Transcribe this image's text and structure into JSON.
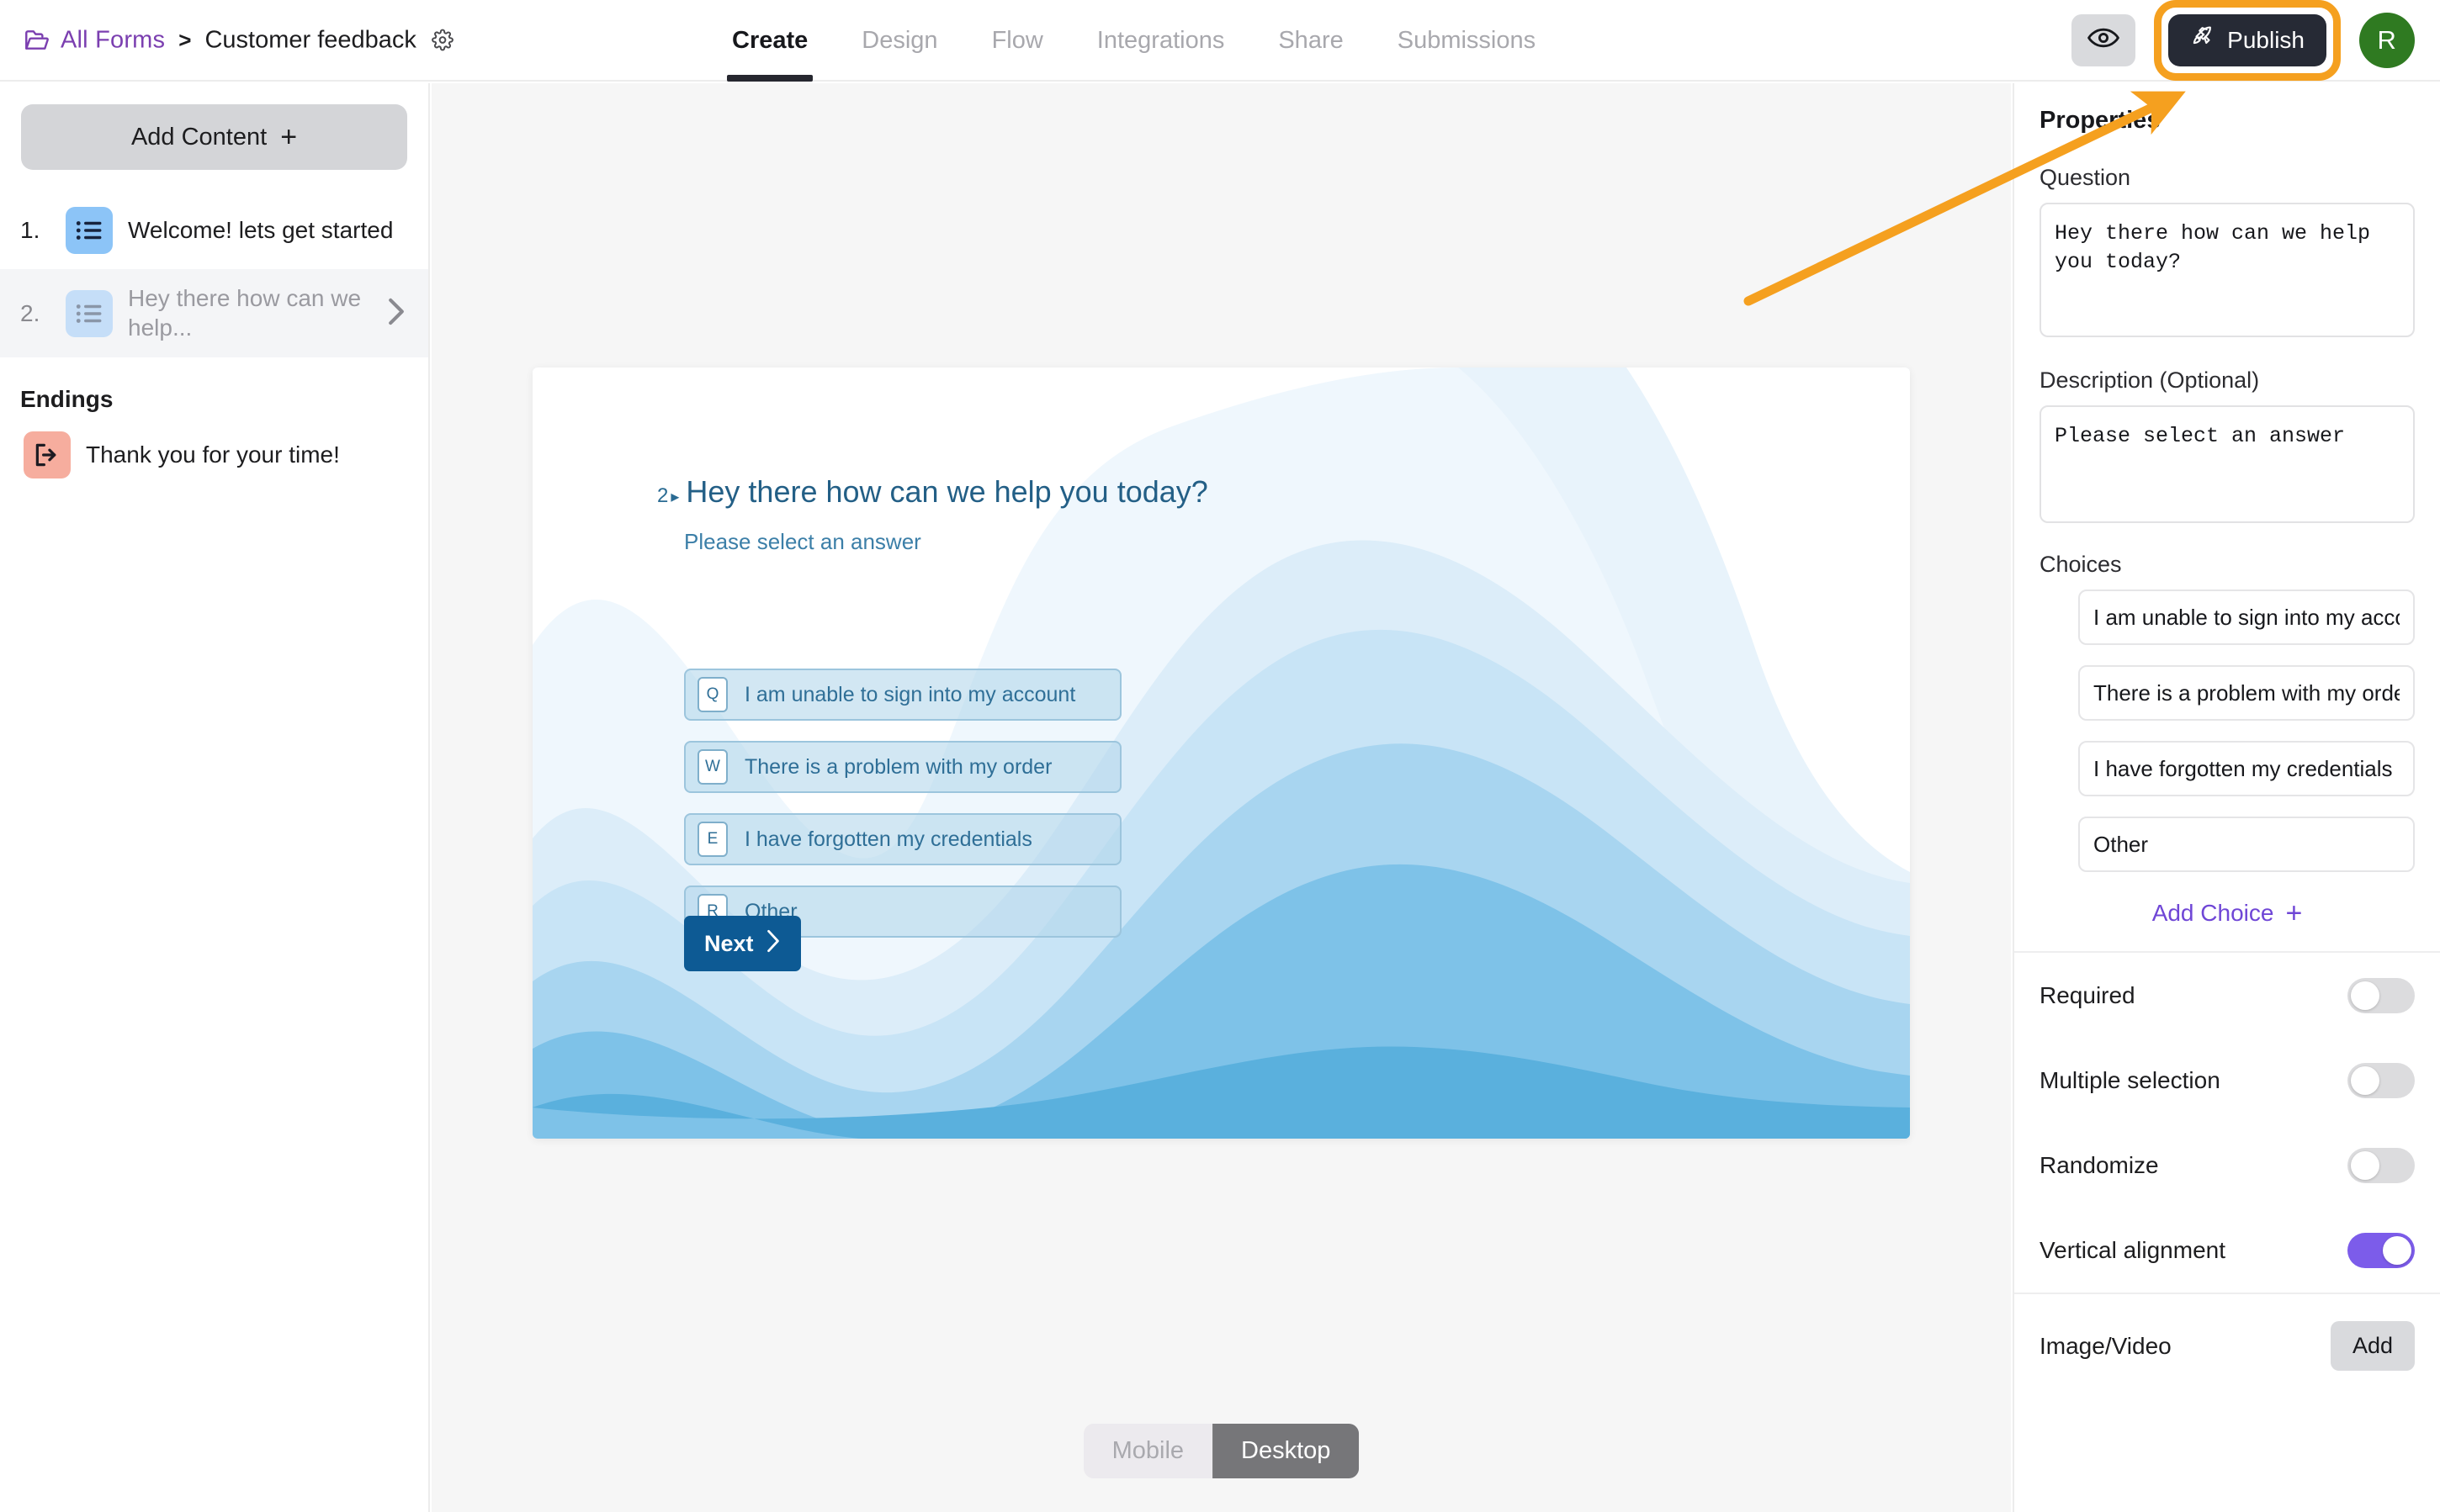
{
  "topbar": {
    "breadcrumb": {
      "all_forms": "All Forms",
      "separator": ">",
      "current": "Customer feedback"
    },
    "tabs": [
      {
        "label": "Create",
        "active": true
      },
      {
        "label": "Design",
        "active": false
      },
      {
        "label": "Flow",
        "active": false
      },
      {
        "label": "Integrations",
        "active": false
      },
      {
        "label": "Share",
        "active": false
      },
      {
        "label": "Submissions",
        "active": false
      }
    ],
    "preview_icon": "eye-icon",
    "publish_label": "Publish",
    "publish_icon": "rocket-icon",
    "avatar_initial": "R",
    "highlight_color": "#f5a01f",
    "publish_bg": "#262a35",
    "avatar_bg": "#2f7a21"
  },
  "sidebar": {
    "add_content_label": "Add Content",
    "items": [
      {
        "num": "1.",
        "label": "Welcome! lets get started",
        "icon": "list-icon",
        "selected": false
      },
      {
        "num": "2.",
        "label": "Hey there how can we help...",
        "icon": "list-icon",
        "selected": true
      }
    ],
    "endings_heading": "Endings",
    "endings": [
      {
        "label": "Thank you for your time!",
        "icon": "exit-icon"
      }
    ]
  },
  "preview": {
    "question_number": "2",
    "question": "Hey there how can we help you today?",
    "description": "Please select an answer",
    "choices": [
      {
        "key": "Q",
        "text": "I am unable to sign into my account"
      },
      {
        "key": "W",
        "text": "There is a problem with my order"
      },
      {
        "key": "E",
        "text": "I have forgotten my credentials"
      },
      {
        "key": "R",
        "text": "Other"
      }
    ],
    "next_label": "Next",
    "device_modes": [
      {
        "label": "Mobile",
        "active": false
      },
      {
        "label": "Desktop",
        "active": true
      }
    ]
  },
  "properties": {
    "title": "Properties",
    "question_label": "Question",
    "question_value": "Hey there how can we help you today?",
    "description_label": "Description (Optional)",
    "description_value": "Please select an answer",
    "choices_label": "Choices",
    "choices": [
      "I am unable to sign into my account",
      "There is a problem with my order",
      "I have forgotten my credentials",
      "Other"
    ],
    "add_choice_label": "Add Choice",
    "toggles": [
      {
        "label": "Required",
        "on": false
      },
      {
        "label": "Multiple selection",
        "on": false
      },
      {
        "label": "Randomize",
        "on": false
      },
      {
        "label": "Vertical alignment",
        "on": true
      }
    ],
    "media_label": "Image/Video",
    "media_button": "Add",
    "accent_color": "#7c5cea"
  }
}
